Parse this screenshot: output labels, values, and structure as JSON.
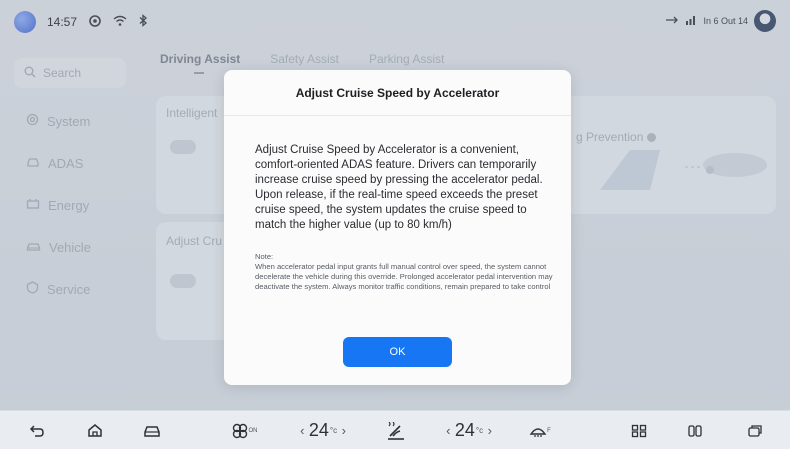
{
  "status_bar": {
    "time": "14:57",
    "right_text": "In 6 Out 14",
    "icons": [
      "app-logo",
      "assistant-icon",
      "wifi-icon",
      "bluetooth-icon",
      "usb-icon",
      "signal-icon",
      "avatar"
    ]
  },
  "sidebar": {
    "search_placeholder": "Search",
    "items": [
      {
        "label": "System",
        "icon": "system-icon"
      },
      {
        "label": "ADAS",
        "icon": "adas-icon"
      },
      {
        "label": "Energy",
        "icon": "energy-icon"
      },
      {
        "label": "Vehicle",
        "icon": "vehicle-icon"
      },
      {
        "label": "Service",
        "icon": "service-icon"
      }
    ]
  },
  "tabs": [
    {
      "label": "Driving Assist",
      "active": true
    },
    {
      "label": "Safety Assist",
      "active": false
    },
    {
      "label": "Parking Assist",
      "active": false
    }
  ],
  "background_cards": {
    "card1_label": "Intelligent",
    "card2_label": "Adjust Cru",
    "prevention_label": "g Prevention"
  },
  "dialog": {
    "title": "Adjust Cruise Speed by Accelerator",
    "body": "Adjust Cruise Speed by Accelerator is a convenient, comfort-oriented ADAS feature. Drivers can temporarily increase cruise speed by pressing the accelerator pedal. Upon release, if the real-time speed exceeds the preset cruise speed, the system updates the cruise speed to match the higher value (up to 80 km/h)",
    "note_title": "Note:",
    "note": "When accelerator pedal input grants full manual control over speed, the system cannot decelerate the vehicle during this override. Prolonged accelerator pedal intervention may deactivate the system. Always monitor traffic conditions, remain prepared to take control",
    "ok_label": "OK"
  },
  "dock": {
    "fan_sub": "ON",
    "left_temp": "24",
    "right_temp": "24",
    "temp_unit": "°c",
    "defrost_sub": "F"
  },
  "colors": {
    "accent": "#1676f3",
    "background": "#e4e8ee",
    "dialog": "#fbfbfc"
  }
}
